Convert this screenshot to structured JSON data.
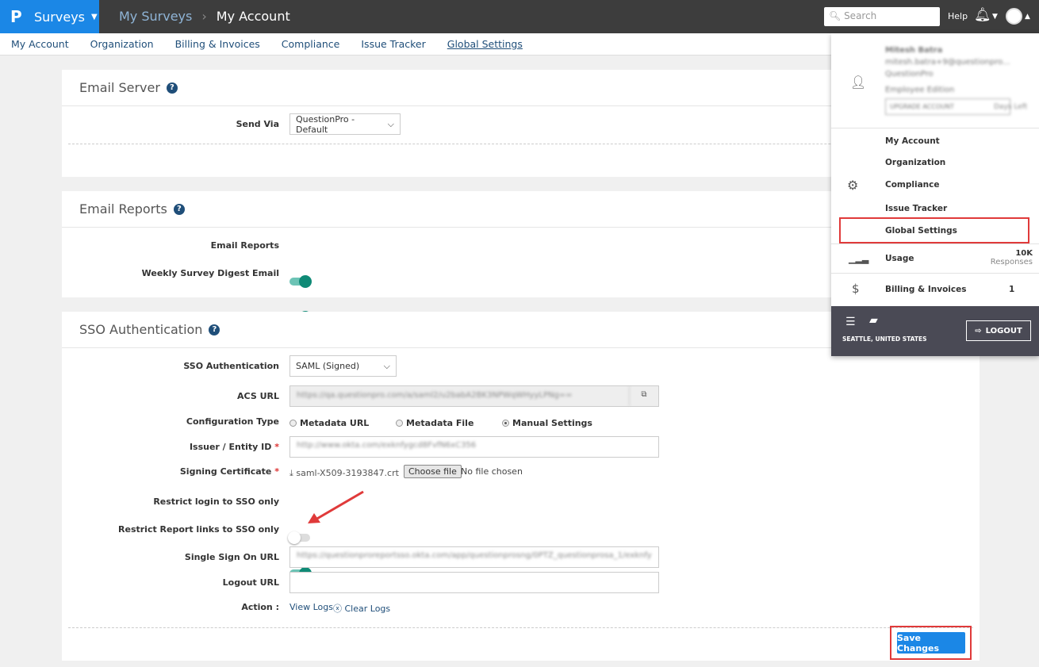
{
  "topbar": {
    "logo": "P",
    "product": "Surveys",
    "breadcrumb": [
      "My Surveys",
      "My Account"
    ],
    "search_placeholder": "Search",
    "help": "Help"
  },
  "subnav": [
    "My Account",
    "Organization",
    "Billing & Invoices",
    "Compliance",
    "Issue Tracker",
    "Global Settings"
  ],
  "email_server": {
    "title": "Email Server",
    "send_via_label": "Send Via",
    "send_via_value": "QuestionPro - Default"
  },
  "email_reports": {
    "title": "Email Reports",
    "rows": [
      {
        "label": "Email Reports",
        "on": true
      },
      {
        "label": "Weekly Survey Digest Email",
        "on": true
      }
    ]
  },
  "sso": {
    "title": "SSO Authentication",
    "auth_label": "SSO Authentication",
    "auth_value": "SAML (Signed)",
    "acs_label": "ACS URL",
    "acs_value": "https://qa.questionpro.com/a/saml2/u2babA2BK3NPWqWHyyLPNg==",
    "config_label": "Configuration Type",
    "config_options": [
      "Metadata URL",
      "Metadata File",
      "Manual Settings"
    ],
    "config_selected": "Manual Settings",
    "issuer_label": "Issuer / Entity ID",
    "issuer_value": "http://www.okta.com/exknfygcd8FvfN6xC356",
    "cert_label": "Signing Certificate",
    "cert_file": "saml-X509-3193847.crt",
    "choose_file": "Choose file",
    "no_file": "No file chosen",
    "restrict_login_label": "Restrict login to SSO only",
    "restrict_login_on": false,
    "restrict_report_label": "Restrict Report links to SSO only",
    "restrict_report_on": true,
    "sso_url_label": "Single Sign On URL",
    "sso_url_value": "https://questionproreportsso.okta.com/app/questionprosng/0PTZ_questionprosa_1/exknfy",
    "logout_url_label": "Logout URL",
    "logout_url_value": "",
    "action_label": "Action :",
    "view_logs": "View Logs",
    "clear_logs": "Clear Logs",
    "save": "Save Changes"
  },
  "menu": {
    "name": "Mitesh Batra",
    "email": "mitesh.batra+9@questionpro...",
    "org": "QuestionPro",
    "edition": "Employee Edition",
    "upgrade": "UPGRADE ACCOUNT",
    "days_left": "Days Left",
    "items": [
      "My Account",
      "Organization",
      "Compliance",
      "Issue Tracker",
      "Global Settings"
    ],
    "usage_label": "Usage",
    "usage_value": "10K",
    "usage_unit": "Responses",
    "billing_label": "Billing & Invoices",
    "billing_count": "1",
    "location": "SEATTLE, UNITED STATES",
    "logout": "LOGOUT"
  },
  "colors": {
    "brand": "#1b87e6",
    "toggle_on": "#0f8a76",
    "highlight": "#e03a3a"
  }
}
